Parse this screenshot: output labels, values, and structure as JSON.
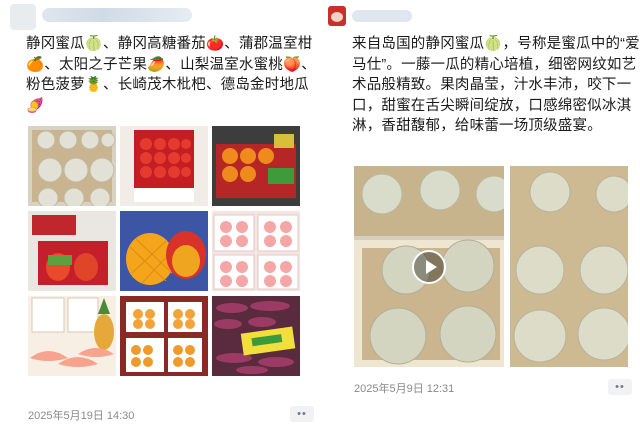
{
  "left_post": {
    "text": "静冈蜜瓜🍈、静冈高糖番茄🍅、蒲郡温室柑🍊、太阳之子芒果🥭、山梨温室水蜜桃🍑、粉色菠萝🍍、长崎茂木枇杷、德岛金时地瓜🍠",
    "date": "2025年5月19日 14:30",
    "more": "••",
    "images": [
      {
        "subject": "melon-boxes"
      },
      {
        "subject": "tomato-box"
      },
      {
        "subject": "citrus-box"
      },
      {
        "subject": "mango-box"
      },
      {
        "subject": "cut-mango"
      },
      {
        "subject": "peach-boxes"
      },
      {
        "subject": "pineapple-slices"
      },
      {
        "subject": "loquat-boxes"
      },
      {
        "subject": "sweet-potatoes"
      }
    ]
  },
  "right_post": {
    "text": "来自岛国的静冈蜜瓜🍈，号称是蜜瓜中的“爱马仕”。一藤一瓜的精心培植，细密网纹如艺术品般精致。果肉晶莹，汁水丰沛，咬下一口，甜蜜在舌尖瞬间绽放，口感绵密似冰淇淋，香甜馥郁，给味蕾一场顶级盛宴。",
    "date": "2025年5月9日 12:31",
    "more": "••"
  },
  "colors": {
    "text": "#1a1a1a",
    "meta": "#8a8a8a",
    "link": "#6c7a99"
  }
}
